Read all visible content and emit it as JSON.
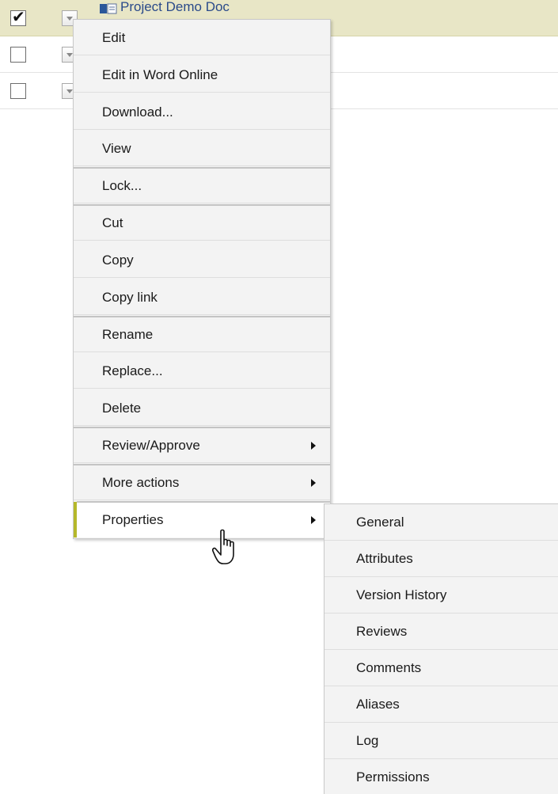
{
  "list": {
    "rows": [
      {
        "checked": true,
        "name": "Project Demo Doc"
      },
      {
        "checked": false,
        "name": ""
      },
      {
        "checked": false,
        "name": ""
      }
    ],
    "checked_glyph": "✔"
  },
  "context_menu": {
    "items": [
      {
        "label": "Edit"
      },
      {
        "label": "Edit in Word Online"
      },
      {
        "label": "Download..."
      },
      {
        "label": "View"
      },
      {
        "label": "Lock..."
      },
      {
        "label": "Cut"
      },
      {
        "label": "Copy"
      },
      {
        "label": "Copy link"
      },
      {
        "label": "Rename"
      },
      {
        "label": "Replace..."
      },
      {
        "label": "Delete"
      },
      {
        "label": "Review/Approve"
      },
      {
        "label": "More actions"
      },
      {
        "label": "Properties"
      }
    ]
  },
  "properties_submenu": {
    "items": [
      {
        "label": "General"
      },
      {
        "label": "Attributes"
      },
      {
        "label": "Version History"
      },
      {
        "label": "Reviews"
      },
      {
        "label": "Comments"
      },
      {
        "label": "Aliases"
      },
      {
        "label": "Log"
      },
      {
        "label": "Permissions"
      }
    ]
  },
  "colors": {
    "selected_row": "#e8e6c6",
    "active_accent": "#b5b82a",
    "menu_bg": "#f3f3f3",
    "doc_link": "#2a4a8a"
  },
  "icons": {
    "doc_icon": "word-document-icon",
    "cursor": "hand-pointer-icon"
  }
}
